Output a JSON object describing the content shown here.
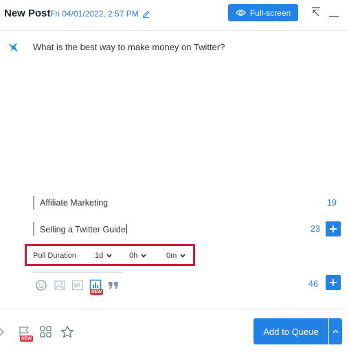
{
  "header": {
    "title": "New Post",
    "date": "Fri 04/01/2022, 2:57 PM",
    "fullscreen_label": "Full-screen"
  },
  "post": {
    "text": "What is the best way to make money on Twitter?"
  },
  "poll": {
    "options": [
      {
        "label": "Affiliate Marketing",
        "remaining": "19"
      },
      {
        "label": "Selling a Twitter Guide",
        "remaining": "23"
      }
    ],
    "duration": {
      "label": "Poll Duration",
      "days": "1d",
      "hours": "0h",
      "minutes": "0m"
    }
  },
  "toolbar": {
    "new_badge": "NEW",
    "char_count": "46"
  },
  "footer": {
    "new_badge": "NEW",
    "add_to_queue_label": "Add to Queue"
  },
  "colors": {
    "accent": "#2183e6",
    "link": "#2a7ad6",
    "highlight_border": "#d4173a",
    "badge": "#e5334b"
  }
}
